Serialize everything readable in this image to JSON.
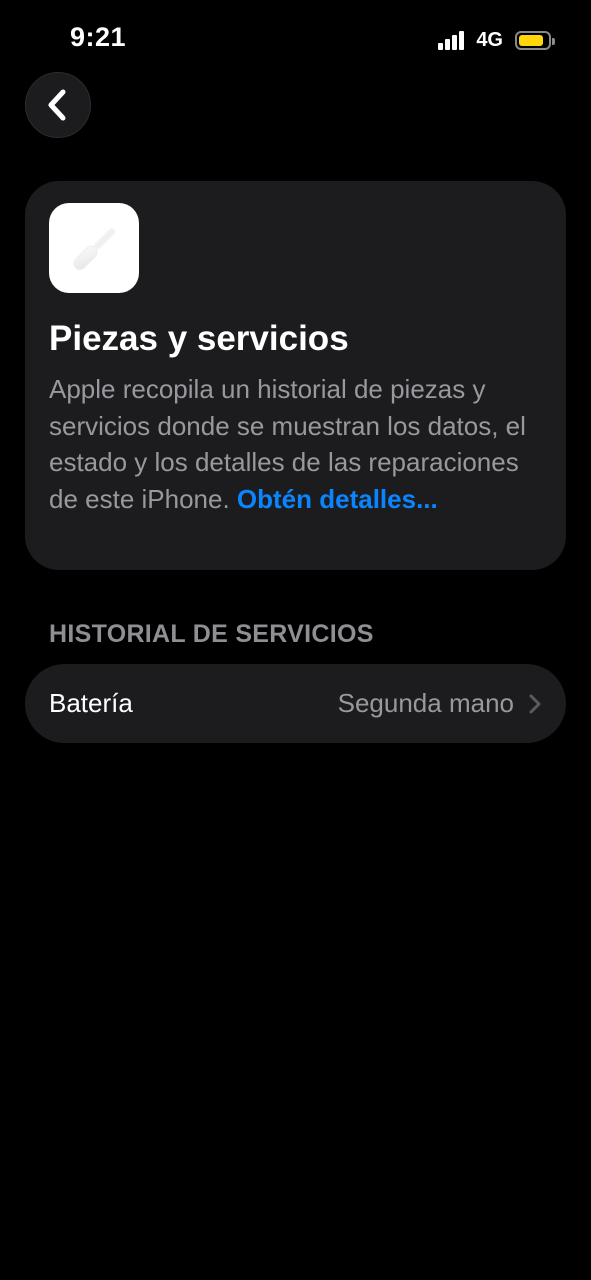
{
  "status_bar": {
    "time": "9:21",
    "network": "4G",
    "signal_bars": 4,
    "battery_color": "#ffd60a",
    "battery_level": 0.85
  },
  "nav": {
    "back_icon": "chevron-left-icon"
  },
  "info_card": {
    "icon": "screwdriver-icon",
    "title": "Piezas y servicios",
    "body": "Apple recopila un historial de piezas y servicios donde se muestran los datos, el estado y los detalles de las reparaciones de este iPhone. ",
    "link": "Obtén detalles...",
    "link_color": "#0a84ff"
  },
  "service_history": {
    "header": "HISTORIAL DE SERVICIOS",
    "rows": [
      {
        "label": "Batería",
        "value": "Segunda mano",
        "icon": "chevron-right-icon"
      }
    ]
  }
}
